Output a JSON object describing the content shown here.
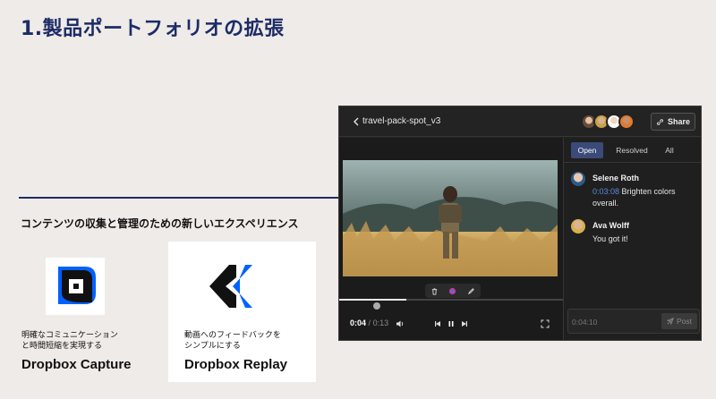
{
  "slide": {
    "title": "1.製品ポートフォリオの拡張",
    "tagline": "コンテンツの収集と管理のための新しいエクスペリエンス"
  },
  "products": [
    {
      "desc_line1": "明確なコミュニケーション",
      "desc_line2": "と時間短縮を実現する",
      "name": "Dropbox Capture",
      "icon": "dropbox-capture-logo",
      "color": "#0061fe"
    },
    {
      "desc_line1": "動画へのフィードバックを",
      "desc_line2": "シンプルにする",
      "name": "Dropbox Replay",
      "icon": "dropbox-replay-logo",
      "color": "#0061fe"
    }
  ],
  "app": {
    "file_title": "travel-pack-spot_v3",
    "share_label": "Share",
    "player": {
      "current_time": "0:04",
      "separator": "/",
      "duration": "0:13",
      "progress": 0.3
    },
    "tabs": [
      {
        "label": "Open",
        "active": true
      },
      {
        "label": "Resolved",
        "active": false
      },
      {
        "label": "All",
        "active": false
      }
    ],
    "comments": [
      {
        "author": "Selene Roth",
        "timestamp": "0:03:08",
        "text": " Brighten colors overall."
      },
      {
        "author": "Ava Wolff",
        "timestamp": "",
        "text": "You got it!"
      }
    ],
    "compose": {
      "time": "0:04:10",
      "post_label": "Post"
    }
  },
  "colors": {
    "title_navy": "#1c2c66",
    "accent_blue": "#0061fe",
    "active_tab": "#3b4a78",
    "timestamp": "#5b8ad9"
  }
}
